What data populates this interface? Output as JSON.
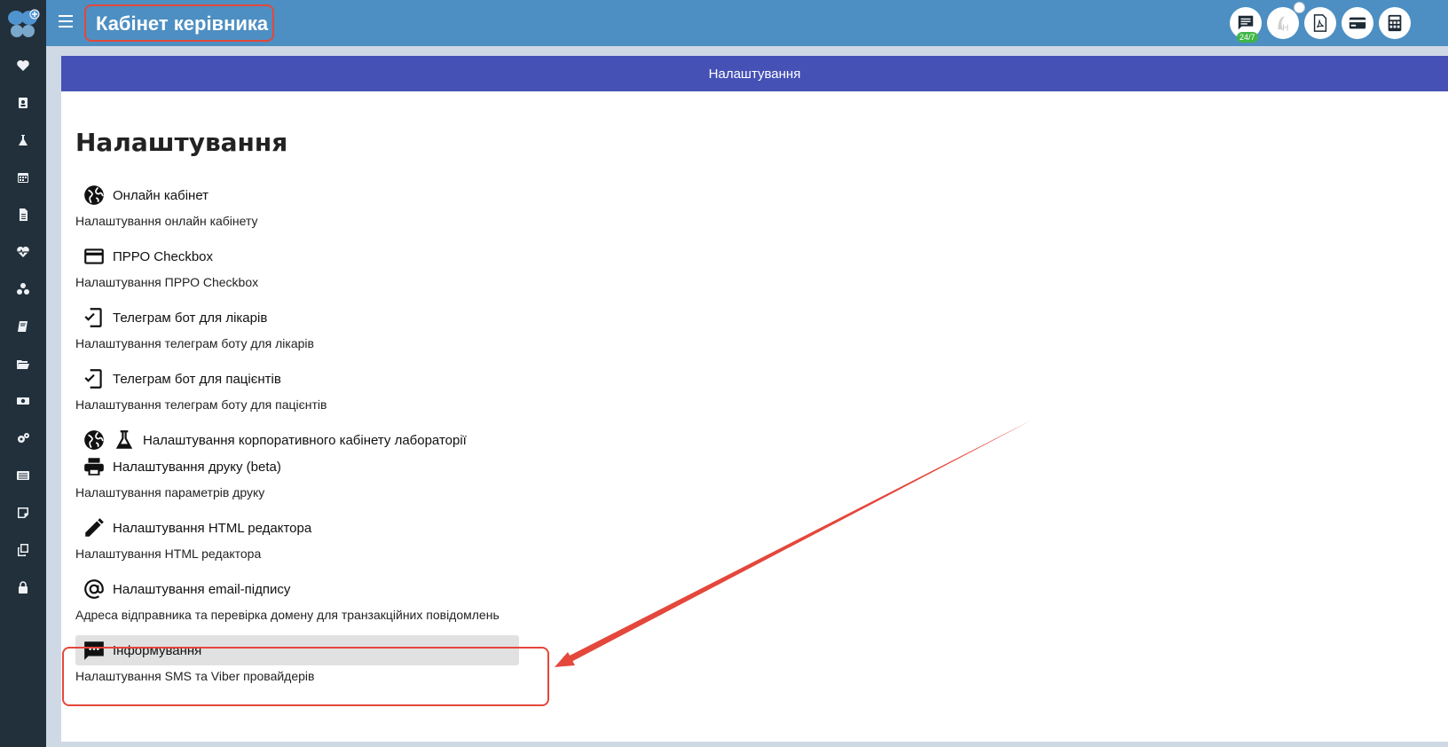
{
  "header": {
    "title": "Кабінет керівника",
    "badge_247": "24/7",
    "buttons": [
      "chat-icon",
      "h-logo-icon",
      "pdf-icon",
      "card-icon",
      "calculator-icon"
    ]
  },
  "sidebar": {
    "items": [
      "heart-icon",
      "contacts-icon",
      "flask-icon",
      "calendar-icon",
      "document-icon",
      "heartbeat-icon",
      "molecules-icon",
      "book-icon",
      "folder-icon",
      "money-icon",
      "gears-icon",
      "list-icon",
      "note-icon",
      "copy-icon",
      "lock-icon"
    ]
  },
  "panel": {
    "header": "Налаштування",
    "title": "Налаштування"
  },
  "settings": [
    {
      "icon": "globe-icon",
      "label": "Онлайн кабінет",
      "desc": "Налаштування онлайн кабінету"
    },
    {
      "icon": "credit-card-icon",
      "label": "ПРРО Checkbox",
      "desc": "Налаштування ПРРО Checkbox"
    },
    {
      "icon": "phone-check-icon",
      "label": "Телеграм бот для лікарів",
      "desc": "Налаштування телеграм боту для лікарів"
    },
    {
      "icon": "phone-check-icon",
      "label": "Телеграм бот для пацієнтів",
      "desc": "Налаштування телеграм боту для пацієнтів"
    },
    {
      "icon": "globe-flask-icon",
      "label": "Налаштування корпоративного кабінету лабораторії",
      "desc": ""
    },
    {
      "icon": "printer-icon",
      "label": "Налаштування друку (beta)",
      "desc": "Налаштування параметрів друку"
    },
    {
      "icon": "pencil-icon",
      "label": "Налаштування HTML редактора",
      "desc": "Налаштування HTML редактора"
    },
    {
      "icon": "at-icon",
      "label": "Налаштування email-підпису",
      "desc": "Адреса відправника та перевірка домену для транзакційних повідомлень"
    },
    {
      "icon": "message-icon",
      "label": "Інформування",
      "desc": "Налаштування SMS та Viber провайдерів"
    }
  ],
  "colors": {
    "sidebar": "#22303b",
    "header": "#4d8fc2",
    "panel_header": "#4551b5",
    "annotation": "#e4473b",
    "active_row": "#e1e1e1"
  }
}
